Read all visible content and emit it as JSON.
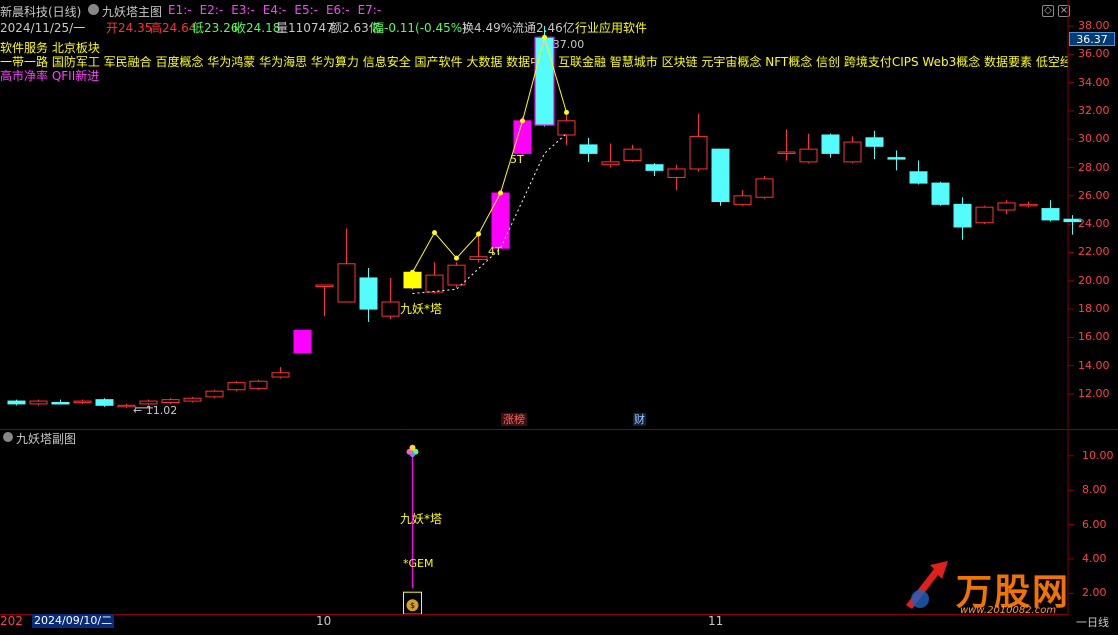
{
  "header": {
    "stock_name": "新晨科技(日线)",
    "main_indicator_label": "九妖塔主图",
    "e_labels": [
      "E1:-",
      "E2:-",
      "E3:-",
      "E4:-",
      "E5:-",
      "E6:-",
      "E7:-"
    ],
    "date": "2024/11/25/一",
    "open": "开24.35",
    "high": "高24.64",
    "low": "低23.26",
    "close": "收24.18",
    "volume": "量110747",
    "amount": "额2.63亿",
    "change": "幅-0.11(-0.45%)",
    "turnover": "换4.49%",
    "float_cap": "流通2.46亿",
    "industry": "行业应用软件"
  },
  "concepts": {
    "line1": "软件服务  北京板块",
    "line2": "一带一路 国防军工 军民融合 百度概念 华为鸿蒙 华为海思 华为算力 信息安全 国产软件 大数据 数据中心 互联金融 智慧城市 区块链 元宇宙概念 NFT概念 信创 跨境支付CIPS Web3概念 数据要素 低空经济",
    "line3": "高市净率 QFII新进"
  },
  "colors": {
    "up": "#ff3232",
    "down": "#54fcfc",
    "magenta": "#ff00ff",
    "yellow": "#ffff00",
    "grid": "#8b0000",
    "axis_text": "#c8c8c8"
  },
  "main_chart": {
    "price_labels": [
      "38.00",
      "36.00",
      "34.00",
      "32.00",
      "30.00",
      "28.00",
      "26.00",
      "24.00",
      "22.00",
      "20.00",
      "18.00",
      "16.00",
      "14.00",
      "12.00"
    ],
    "current_price_tag": "36.37",
    "low_annotation": "11.02",
    "high_annotation": "37.00",
    "pattern_label": "九妖*塔",
    "marker_4t": "4T",
    "marker_5t": "5T",
    "event_tag_zhangbang": "涨榜",
    "event_tag_cai": "财"
  },
  "sub_chart": {
    "title": "九妖塔副图",
    "price_labels": [
      "10.00",
      "8.00",
      "6.00",
      "4.00",
      "2.00"
    ],
    "signal_label": "九妖*塔",
    "gem_label": "*GEM",
    "money_icon": "money-bag-icon",
    "clover_icon": "clover-icon"
  },
  "timeline": {
    "year_prefix": "202",
    "cursor_date": "2024/09/10/二",
    "month_10": "10",
    "month_11": "11"
  },
  "right_panel": {
    "label_tail": "一日线"
  },
  "watermark": {
    "brand": "万股网",
    "url": "www.2010082.com"
  },
  "chart_data": {
    "type": "candlestick",
    "ylim": [
      11,
      38.5
    ],
    "candles": [
      {
        "o": 11.5,
        "c": 11.3,
        "h": 11.6,
        "l": 11.2,
        "color": "down"
      },
      {
        "o": 11.3,
        "c": 11.5,
        "h": 11.6,
        "l": 11.2,
        "color": "up"
      },
      {
        "o": 11.4,
        "c": 11.4,
        "h": 11.6,
        "l": 11.3,
        "color": "down"
      },
      {
        "o": 11.4,
        "c": 11.5,
        "h": 11.6,
        "l": 11.3,
        "color": "up"
      },
      {
        "o": 11.6,
        "c": 11.2,
        "h": 11.7,
        "l": 11.1,
        "color": "down"
      },
      {
        "o": 11.2,
        "c": 11.1,
        "h": 11.3,
        "l": 11.02,
        "color": "up"
      },
      {
        "o": 11.3,
        "c": 11.5,
        "h": 11.6,
        "l": 11.2,
        "color": "up"
      },
      {
        "o": 11.4,
        "c": 11.6,
        "h": 11.7,
        "l": 11.3,
        "color": "up"
      },
      {
        "o": 11.5,
        "c": 11.7,
        "h": 11.8,
        "l": 11.4,
        "color": "up"
      },
      {
        "o": 11.8,
        "c": 12.2,
        "h": 12.3,
        "l": 11.7,
        "color": "up"
      },
      {
        "o": 12.3,
        "c": 12.8,
        "h": 12.9,
        "l": 12.2,
        "color": "up"
      },
      {
        "o": 12.4,
        "c": 12.9,
        "h": 13.0,
        "l": 12.3,
        "color": "up"
      },
      {
        "o": 13.2,
        "c": 13.5,
        "h": 13.9,
        "l": 13.1,
        "color": "up"
      },
      {
        "o": 14.9,
        "c": 16.5,
        "h": 16.5,
        "l": 14.9,
        "color": "magenta"
      },
      {
        "o": 19.7,
        "c": 19.7,
        "h": 19.7,
        "l": 17.5,
        "color": "up"
      },
      {
        "o": 18.5,
        "c": 21.2,
        "h": 23.7,
        "l": 18.5,
        "color": "up"
      },
      {
        "o": 20.2,
        "c": 18.0,
        "h": 20.9,
        "l": 17.1,
        "color": "down"
      },
      {
        "o": 17.5,
        "c": 18.5,
        "h": 20.2,
        "l": 17.3,
        "color": "up"
      },
      {
        "o": 19.5,
        "c": 20.6,
        "h": 20.6,
        "l": 19.4,
        "color": "yellow"
      },
      {
        "o": 19.2,
        "c": 20.4,
        "h": 21.3,
        "l": 19.1,
        "color": "up"
      },
      {
        "o": 19.7,
        "c": 21.1,
        "h": 21.3,
        "l": 19.5,
        "color": "up"
      },
      {
        "o": 21.5,
        "c": 21.7,
        "h": 23.3,
        "l": 21.3,
        "color": "up"
      },
      {
        "o": 22.3,
        "c": 26.2,
        "h": 26.4,
        "l": 22.3,
        "color": "magenta"
      },
      {
        "o": 29.0,
        "c": 31.3,
        "h": 31.6,
        "l": 28.9,
        "color": "magenta"
      },
      {
        "o": 31.0,
        "c": 37.2,
        "h": 38.0,
        "l": 30.9,
        "color": "magenta_down"
      },
      {
        "o": 30.3,
        "c": 31.3,
        "h": 31.9,
        "l": 29.6,
        "color": "up"
      },
      {
        "o": 29.6,
        "c": 29.0,
        "h": 30.1,
        "l": 28.4,
        "color": "down"
      },
      {
        "o": 28.4,
        "c": 28.2,
        "h": 29.7,
        "l": 28.0,
        "color": "up"
      },
      {
        "o": 28.5,
        "c": 29.3,
        "h": 29.6,
        "l": 28.4,
        "color": "up"
      },
      {
        "o": 28.2,
        "c": 27.8,
        "h": 28.3,
        "l": 27.4,
        "color": "down"
      },
      {
        "o": 27.3,
        "c": 27.9,
        "h": 28.2,
        "l": 26.4,
        "color": "up"
      },
      {
        "o": 27.9,
        "c": 30.2,
        "h": 31.8,
        "l": 27.7,
        "color": "up"
      },
      {
        "o": 29.3,
        "c": 25.6,
        "h": 29.3,
        "l": 25.3,
        "color": "down"
      },
      {
        "o": 25.4,
        "c": 26.0,
        "h": 26.4,
        "l": 25.3,
        "color": "up"
      },
      {
        "o": 25.9,
        "c": 27.2,
        "h": 27.4,
        "l": 25.8,
        "color": "up"
      },
      {
        "o": 29.0,
        "c": 29.1,
        "h": 30.7,
        "l": 28.5,
        "color": "up"
      },
      {
        "o": 28.4,
        "c": 29.3,
        "h": 30.4,
        "l": 28.3,
        "color": "up"
      },
      {
        "o": 30.3,
        "c": 29.0,
        "h": 30.4,
        "l": 28.7,
        "color": "down"
      },
      {
        "o": 28.4,
        "c": 29.8,
        "h": 30.2,
        "l": 28.3,
        "color": "up"
      },
      {
        "o": 30.1,
        "c": 29.5,
        "h": 30.6,
        "l": 28.6,
        "color": "down"
      },
      {
        "o": 28.7,
        "c": 28.7,
        "h": 29.2,
        "l": 27.8,
        "color": "down"
      },
      {
        "o": 27.7,
        "c": 26.9,
        "h": 28.5,
        "l": 26.8,
        "color": "down"
      },
      {
        "o": 26.9,
        "c": 25.4,
        "h": 27.0,
        "l": 25.3,
        "color": "down"
      },
      {
        "o": 25.4,
        "c": 23.8,
        "h": 25.9,
        "l": 22.9,
        "color": "down"
      },
      {
        "o": 24.1,
        "c": 25.2,
        "h": 25.3,
        "l": 24.0,
        "color": "up"
      },
      {
        "o": 25.0,
        "c": 25.5,
        "h": 25.7,
        "l": 24.7,
        "color": "up"
      },
      {
        "o": 25.4,
        "c": 25.4,
        "h": 25.6,
        "l": 25.2,
        "color": "up"
      },
      {
        "o": 25.1,
        "c": 24.3,
        "h": 25.7,
        "l": 24.2,
        "color": "down"
      },
      {
        "o": 24.35,
        "c": 24.18,
        "h": 24.64,
        "l": 23.26,
        "color": "down"
      }
    ],
    "pattern_line": [
      {
        "i": 18,
        "y": 20.6
      },
      {
        "i": 19,
        "y": 23.4
      },
      {
        "i": 20,
        "y": 21.6
      },
      {
        "i": 21,
        "y": 23.3
      },
      {
        "i": 22,
        "y": 26.2
      },
      {
        "i": 23,
        "y": 31.3
      },
      {
        "i": 24,
        "y": 37.2
      },
      {
        "i": 25,
        "y": 31.9
      }
    ],
    "sub_signal_value": 10.0,
    "sub_gem_value": 2.3,
    "sub_ylim": [
      0.8,
      11.5
    ]
  }
}
